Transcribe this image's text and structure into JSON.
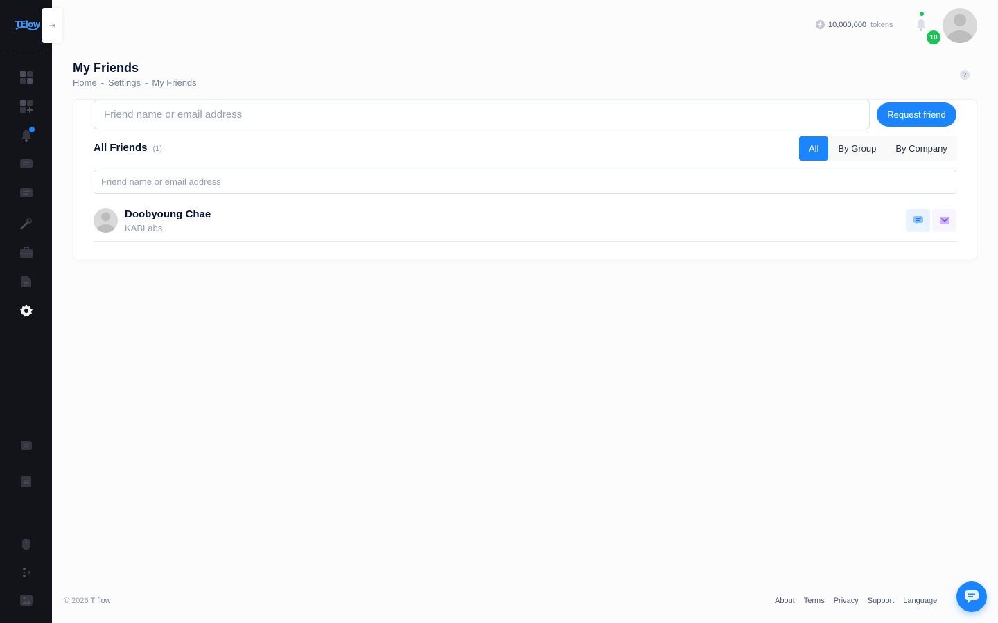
{
  "app": {
    "logo_text": "TFlow"
  },
  "sidebar": {
    "collapse_glyph": "⇥",
    "icons": [
      "dashboard-icon",
      "add-widget-icon",
      "notification-bell-icon",
      "chat-icon",
      "messages-icon",
      "wrench-icon",
      "briefcase-icon",
      "document-icon",
      "settings-gear-icon",
      "chat-bottom-icon",
      "notes-icon",
      "mouse-icon",
      "dots-icon",
      "image-icon"
    ]
  },
  "header": {
    "tokens_value": "10,000,000",
    "tokens_unit": "tokens",
    "notification_count": "10"
  },
  "page": {
    "title": "My Friends",
    "breadcrumb": [
      "Home",
      "Settings",
      "My Friends"
    ],
    "breadcrumb_sep": "-",
    "help_glyph": "?"
  },
  "request": {
    "placeholder": "Friend name or email address",
    "button_label": "Request friend"
  },
  "friends": {
    "title": "All Friends",
    "count": "(1)",
    "tabs": [
      "All",
      "By Group",
      "By Company"
    ],
    "active_tab": "All",
    "filter_placeholder": "Friend name or email address",
    "items": [
      {
        "name": "Doobyoung Chae",
        "company": "KABLabs"
      }
    ]
  },
  "footer": {
    "copyright": "© 2026",
    "brand": "T flow",
    "links": [
      "About",
      "Terms",
      "Privacy",
      "Support",
      "Language"
    ]
  },
  "colors": {
    "sidebar_bg": "#131419",
    "primary": "#1b84ff",
    "success": "#17c653",
    "page_bg": "#fcfcfd"
  }
}
